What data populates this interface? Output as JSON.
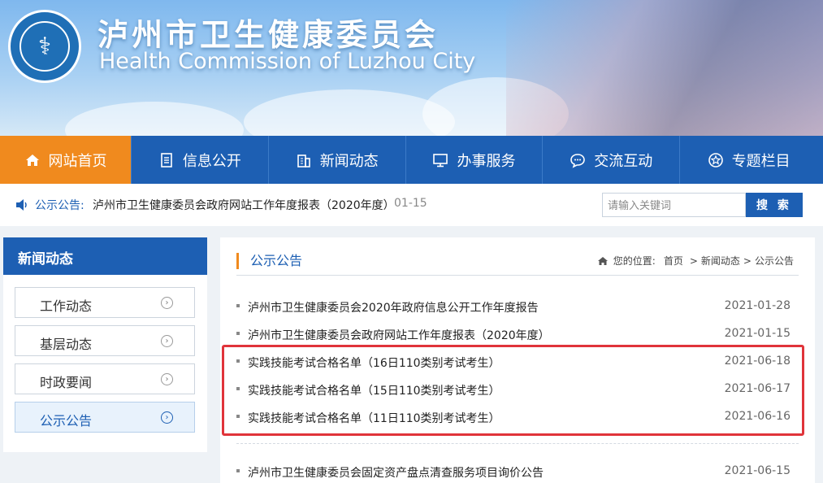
{
  "header": {
    "title": "泸州市卫生健康委员会",
    "subtitle": "Health Commission of Luzhou City",
    "logo_text": "泸州市卫生健康委员会 Health Commission of Luzhou City"
  },
  "nav": {
    "items": [
      {
        "label": "网站首页",
        "icon": "home-icon"
      },
      {
        "label": "信息公开",
        "icon": "document-icon"
      },
      {
        "label": "新闻动态",
        "icon": "building-icon"
      },
      {
        "label": "办事服务",
        "icon": "monitor-icon"
      },
      {
        "label": "交流互动",
        "icon": "chat-icon"
      },
      {
        "label": "专题栏目",
        "icon": "star-icon"
      }
    ]
  },
  "notice": {
    "label": "公示公告:",
    "text": "泸州市卫生健康委员会政府网站工作年度报表（2020年度）",
    "date": "01-15"
  },
  "search": {
    "placeholder": "请输入关键词",
    "button": "搜 索"
  },
  "sidebar": {
    "title": "新闻动态",
    "items": [
      {
        "label": "工作动态"
      },
      {
        "label": "基层动态"
      },
      {
        "label": "时政要闻"
      },
      {
        "label": "公示公告"
      }
    ]
  },
  "main": {
    "title": "公示公告",
    "breadcrumb": {
      "prefix": "您的位置:",
      "home": "首页",
      "sep1": ">",
      "section": "新闻动态",
      "sep2": ">",
      "current": "公示公告"
    },
    "list": [
      {
        "title": "泸州市卫生健康委员会2020年政府信息公开工作年度报告",
        "date": "2021-01-28"
      },
      {
        "title": "泸州市卫生健康委员会政府网站工作年度报表（2020年度）",
        "date": "2021-01-15"
      },
      {
        "title": "实践技能考试合格名单（16日110类别考试考生）",
        "date": "2021-06-18"
      },
      {
        "title": "实践技能考试合格名单（15日110类别考试考生）",
        "date": "2021-06-17"
      },
      {
        "title": "实践技能考试合格名单（11日110类别考试考生）",
        "date": "2021-06-16"
      },
      {
        "title": "泸州市卫生健康委员会固定资产盘点清查服务项目询价公告",
        "date": "2021-06-15"
      }
    ]
  },
  "colors": {
    "primary": "#1d5fb3",
    "accent": "#f08a1e",
    "highlight": "#e0343a"
  }
}
